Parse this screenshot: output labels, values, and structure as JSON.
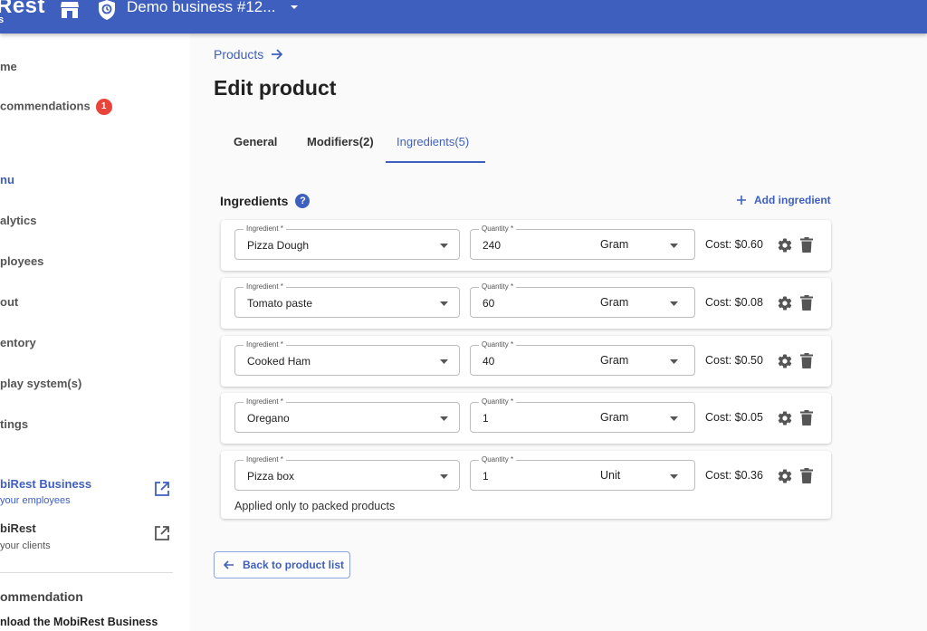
{
  "header": {
    "logo": "Rest",
    "logo_sub": "s",
    "business_name": "Demo business #12...",
    "icons": [
      "store-icon",
      "shield-icon",
      "caret-down-icon"
    ]
  },
  "sidebar": {
    "items": [
      {
        "label": "me"
      },
      {
        "label": "commendations",
        "badge": "1"
      },
      {
        "label": "nu"
      },
      {
        "label": "alytics"
      },
      {
        "label": "ployees"
      },
      {
        "label": "out"
      },
      {
        "label": "entory"
      },
      {
        "label": "play system(s)"
      },
      {
        "label": "tings"
      }
    ],
    "apps": [
      {
        "title": "biRest Business",
        "subtitle": "your employees"
      },
      {
        "title": "biRest",
        "subtitle": "your clients"
      }
    ],
    "recommendation_title": "ommendation",
    "recommendation_text": "nload the MobiRest Business"
  },
  "main": {
    "breadcrumb": "Products",
    "title": "Edit product",
    "tabs": [
      {
        "label": "General"
      },
      {
        "label": "Modifiers(2)"
      },
      {
        "label": "Ingredients(5)"
      }
    ],
    "active_tab": "Ingredients(5)",
    "section_title": "Ingredients",
    "help_glyph": "?",
    "add_label": "Add ingredient",
    "ingredient_label": "Ingredient *",
    "quantity_label": "Quantity *",
    "ingredients": [
      {
        "name": "Pizza Dough",
        "quantity": "240",
        "unit": "Gram",
        "cost": "Cost: $0.60"
      },
      {
        "name": "Tomato paste",
        "quantity": "60",
        "unit": "Gram",
        "cost": "Cost: $0.08"
      },
      {
        "name": "Cooked Ham",
        "quantity": "40",
        "unit": "Gram",
        "cost": "Cost: $0.50"
      },
      {
        "name": "Oregano",
        "quantity": "1",
        "unit": "Gram",
        "cost": "Cost: $0.05"
      },
      {
        "name": "Pizza box",
        "quantity": "1",
        "unit": "Unit",
        "cost": "Cost: $0.36",
        "note": "Applied only to packed products"
      }
    ],
    "back_label": "Back to product list"
  },
  "colors": {
    "primary": "#3f5fbf",
    "badge": "#e8443a"
  }
}
